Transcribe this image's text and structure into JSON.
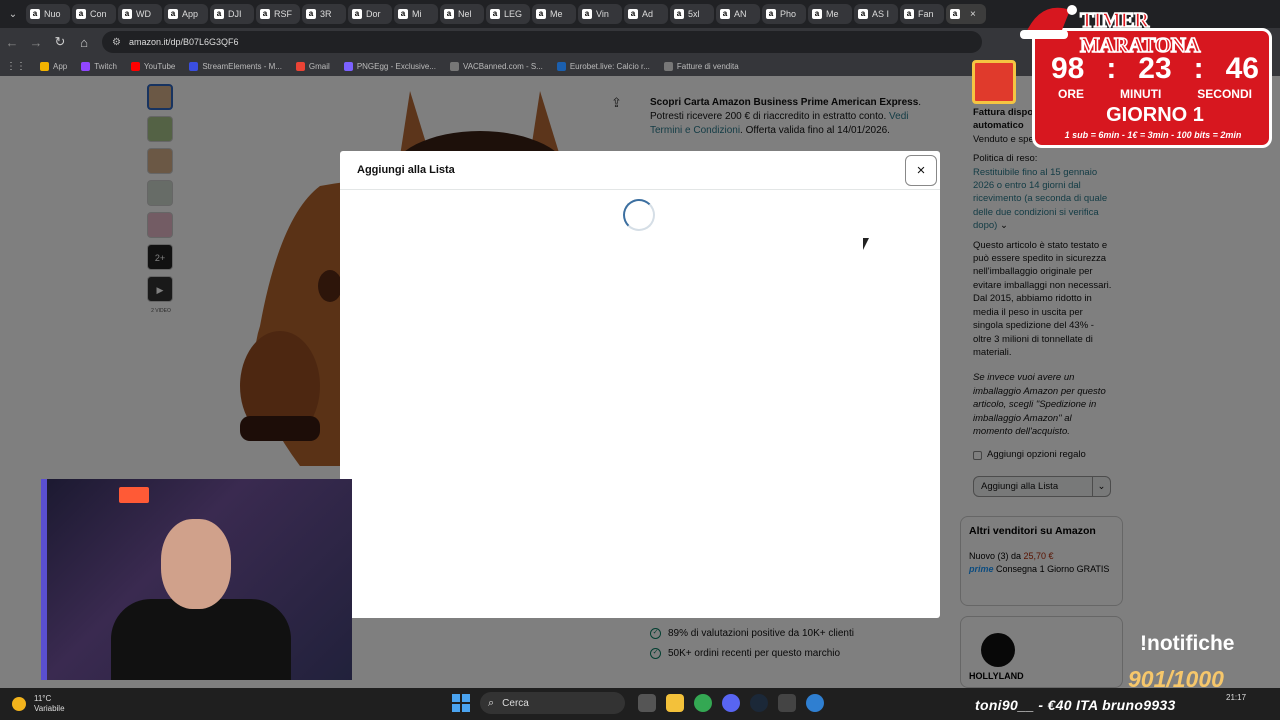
{
  "browser": {
    "tabs": [
      {
        "label": "Nuo"
      },
      {
        "label": "Con"
      },
      {
        "label": "WD"
      },
      {
        "label": "App"
      },
      {
        "label": "DJI"
      },
      {
        "label": "RSF"
      },
      {
        "label": "3R"
      },
      {
        "label": "Dor"
      },
      {
        "label": "Mi"
      },
      {
        "label": "Nel"
      },
      {
        "label": "LEG"
      },
      {
        "label": "Me"
      },
      {
        "label": "Vin"
      },
      {
        "label": "Ad"
      },
      {
        "label": "5xl"
      },
      {
        "label": "AN"
      },
      {
        "label": "Pho"
      },
      {
        "label": "Me"
      },
      {
        "label": "AS I"
      },
      {
        "label": "Fan"
      }
    ],
    "active_tab_close": "×",
    "url": "amazon.it/dp/B07L6G3QF6",
    "bookmarks": [
      {
        "label": "App",
        "color": "#f4b400"
      },
      {
        "label": "Twitch",
        "color": "#9146ff"
      },
      {
        "label": "YouTube",
        "color": "#ff0000"
      },
      {
        "label": "StreamElements - M...",
        "color": "#3a4ee0"
      },
      {
        "label": "Gmail",
        "color": "#ea4335"
      },
      {
        "label": "PNGEgg - Exclusive...",
        "color": "#7b61ff"
      },
      {
        "label": "VACBanned.com - S...",
        "color": "#777"
      },
      {
        "label": "Eurobet.live: Calcio r...",
        "color": "#1b5fae"
      },
      {
        "label": "Fatture di vendita",
        "color": "#777"
      }
    ]
  },
  "product": {
    "offer_bold": "Scopri Carta Amazon Business Prime American Express",
    "offer_text1": ". Potresti ricevere 200 € di riaccredito in estratto conto. ",
    "offer_link": "Vedi Termini e Condizioni",
    "offer_text2": ". Offerta valida fino al 14/01/2026.",
    "thumb_more": "2+",
    "video_label": "2 VIDEO",
    "side": {
      "invoice_label": "Fattura dispo",
      "invoice_sub": "automatico",
      "sold_by": "Venduto e spe",
      "returns_title": "Politica di reso:",
      "returns_link": "Restituibile fino al 15 gennaio 2026 o entro 14 giorni dal ricevimento (a seconda di quale delle due condizioni si verifica dopo)",
      "packaging": "Questo articolo è stato testato e può essere spedito in sicurezza nell'imballaggio originale per evitare imballaggi non necessari. Dal 2015, abbiamo ridotto in media il peso in uscita per singola spedizione del 43% - oltre 3 milioni di tonnellate di materiali.",
      "packaging_italic": "Se invece vuoi avere un imballaggio Amazon per questo articolo, scegli \"Spedizione in imballaggio Amazon\" al momento dell'acquisto.",
      "gift_option": "Aggiungi opzioni regalo",
      "add_list": "Aggiungi alla Lista"
    },
    "sellers": {
      "title": "Altri venditori su Amazon",
      "new_prefix": "Nuovo (3) da ",
      "new_price": "25,70 €",
      "prime": "prime",
      "delivery": "Consegna 1 Giorno GRATIS"
    },
    "ad_brand": "HOLLYLAND",
    "badges": [
      "89% di valutazioni positive da 10K+ clienti",
      "50K+ ordini recenti per questo marchio"
    ]
  },
  "modal": {
    "title": "Aggiungi alla Lista",
    "close": "×"
  },
  "overlay": {
    "timer_title": "TIMER MARATONA",
    "hours": "98",
    "minutes": "23",
    "seconds": "46",
    "hours_label": "ORE",
    "minutes_label": "MINUTI",
    "seconds_label": "SECONDI",
    "day": "GIORNO 1",
    "rules": "1 sub = 6min - 1€ = 3min - 100 bits = 2min",
    "notif_cmd": "!notifiche",
    "notif_count": "901/1000"
  },
  "taskbar": {
    "temp": "11°C",
    "weather": "Variabile",
    "search": "Cerca",
    "ticker": "toni90__ - €40   ITA   bruno9933",
    "time": "21:17"
  }
}
